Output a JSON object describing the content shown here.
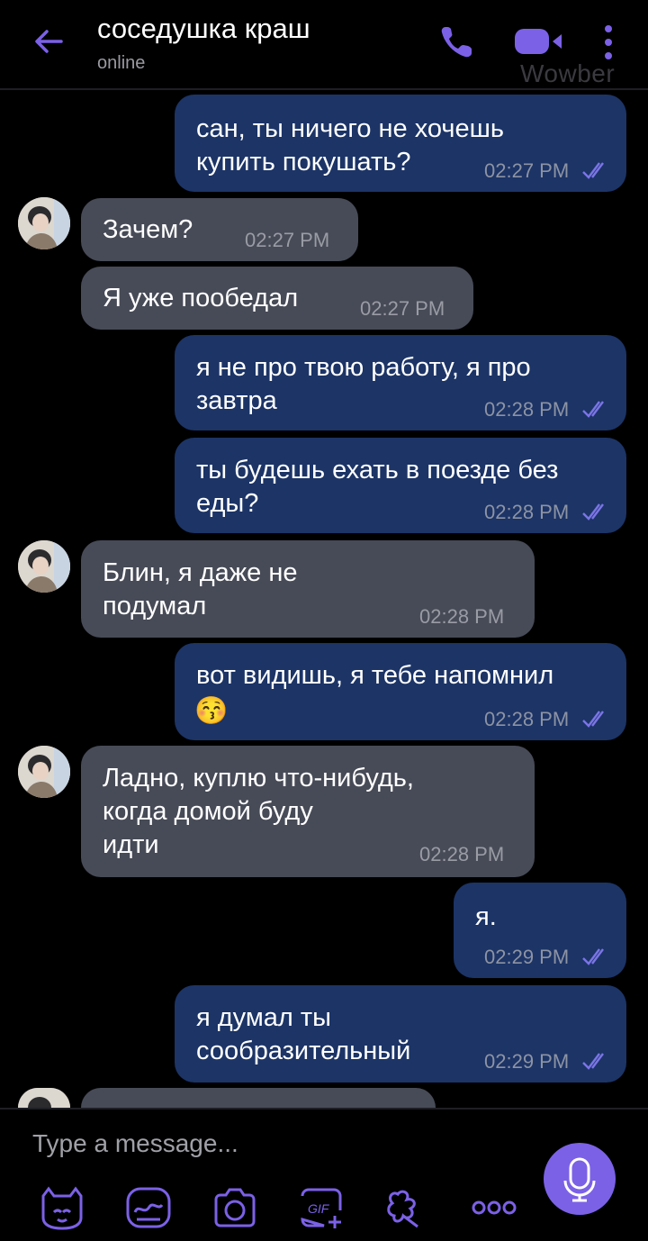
{
  "header": {
    "title": "соседушка краш",
    "status": "online",
    "watermark": "Wowber"
  },
  "messages": [
    {
      "dir": "out",
      "text": "сан, ты ничего не хочешь\nкупить покушать?",
      "time": "02:27 PM"
    },
    {
      "dir": "in",
      "text": "Зачем?",
      "time": "02:27 PM"
    },
    {
      "dir": "in",
      "text": "Я уже пообедал",
      "time": "02:27 PM"
    },
    {
      "dir": "out",
      "text": "я не про твою работу, я про\nзавтра",
      "time": "02:28 PM"
    },
    {
      "dir": "out",
      "text": "ты будешь ехать в поезде без\nеды?",
      "time": "02:28 PM"
    },
    {
      "dir": "in",
      "text": "Блин, я даже не\nподумал",
      "time": "02:28 PM"
    },
    {
      "dir": "out",
      "text": "вот видишь, я тебе напомнил",
      "emoji": "😚",
      "time": "02:28 PM"
    },
    {
      "dir": "in",
      "text": "Ладно, куплю что-нибудь,\nкогда домой буду\nидти",
      "time": "02:28 PM"
    },
    {
      "dir": "out",
      "text": "я.",
      "time": "02:29 PM"
    },
    {
      "dir": "out",
      "text": "я думал ты\nсообразительный",
      "time": "02:29 PM"
    }
  ],
  "composer": {
    "placeholder": "Type a message...",
    "tools": [
      "sticker-icon",
      "doodle-icon",
      "camera-icon",
      "gif-icon",
      "emoticon-icon",
      "more-options-icon"
    ]
  },
  "colors": {
    "accent": "#7b61e6",
    "outgoing_bubble": "#1c3466",
    "incoming_bubble": "#474b57",
    "read_ticks": "#7b74e6"
  }
}
